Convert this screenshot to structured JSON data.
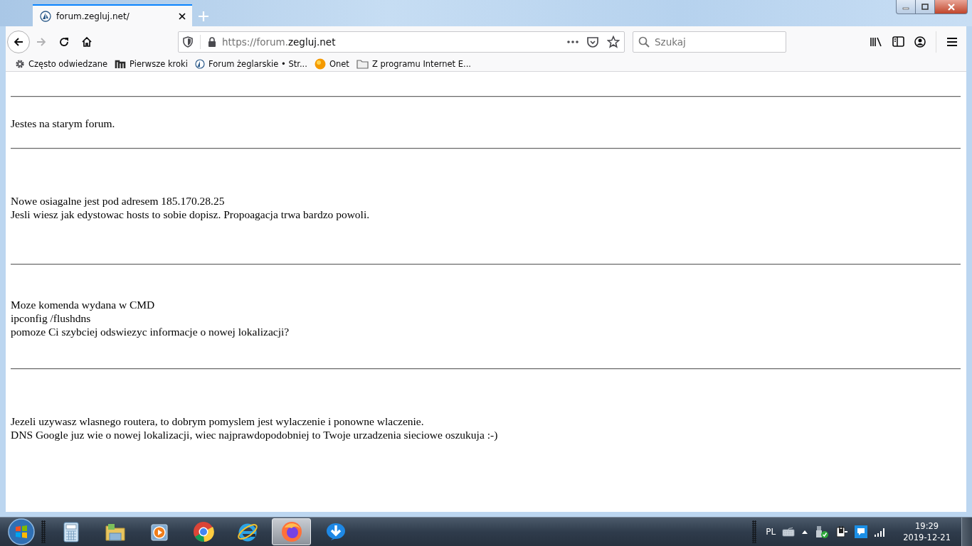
{
  "window": {
    "controls": [
      {
        "kind": "minimize"
      },
      {
        "kind": "maximize"
      },
      {
        "kind": "close"
      }
    ]
  },
  "tabs": [
    {
      "title": "forum.zegluj.net/",
      "selected": true
    }
  ],
  "toolbar": {
    "url": {
      "dim": "https://forum.",
      "main": "zegluj.net"
    },
    "search": {
      "placeholder": "Szukaj"
    }
  },
  "bookmarks": [
    {
      "kind": "gear",
      "label": "Często odwiedzane"
    },
    {
      "kind": "m",
      "label": "Pierwsze kroki"
    },
    {
      "kind": "site",
      "label": "Forum żeglarskie • Str..."
    },
    {
      "kind": "orb",
      "label": "Onet"
    },
    {
      "kind": "folder",
      "label": "Z programu Internet E..."
    }
  ],
  "page": {
    "sections": [
      {
        "lines": [
          "Jestes na starym forum."
        ]
      },
      {
        "lines": [
          "Nowe osiagalne jest pod adresem 185.170.28.25",
          "Jesli wiesz jak edystowac hosts to sobie dopisz. Propoagacja trwa bardzo powoli."
        ]
      },
      {
        "lines": [
          "Moze komenda wydana w CMD",
          "ipconfig /flushdns",
          "pomoze Ci szybciej odswiezyc informacje o nowej lokalizacji?"
        ]
      },
      {
        "lines": [
          "Jezeli uzywasz wlasnego routera, to dobrym pomyslem jest wylaczenie i ponowne wlaczenie.",
          "DNS Google juz wie o nowej lokalizacji, wiec najprawdopodobniej to Twoje urzadzenia sieciowe oszukuja :-)"
        ]
      }
    ]
  },
  "taskbar": {
    "apps": [
      {
        "kind": "calculator",
        "selected": false
      },
      {
        "kind": "folder",
        "selected": false
      },
      {
        "kind": "media",
        "selected": false
      },
      {
        "kind": "chrome",
        "selected": false
      },
      {
        "kind": "ie",
        "selected": false
      },
      {
        "kind": "firefox",
        "selected": true
      },
      {
        "kind": "download",
        "selected": false
      }
    ],
    "language": "PL",
    "time": "19:29",
    "date": "2019-12-21"
  }
}
